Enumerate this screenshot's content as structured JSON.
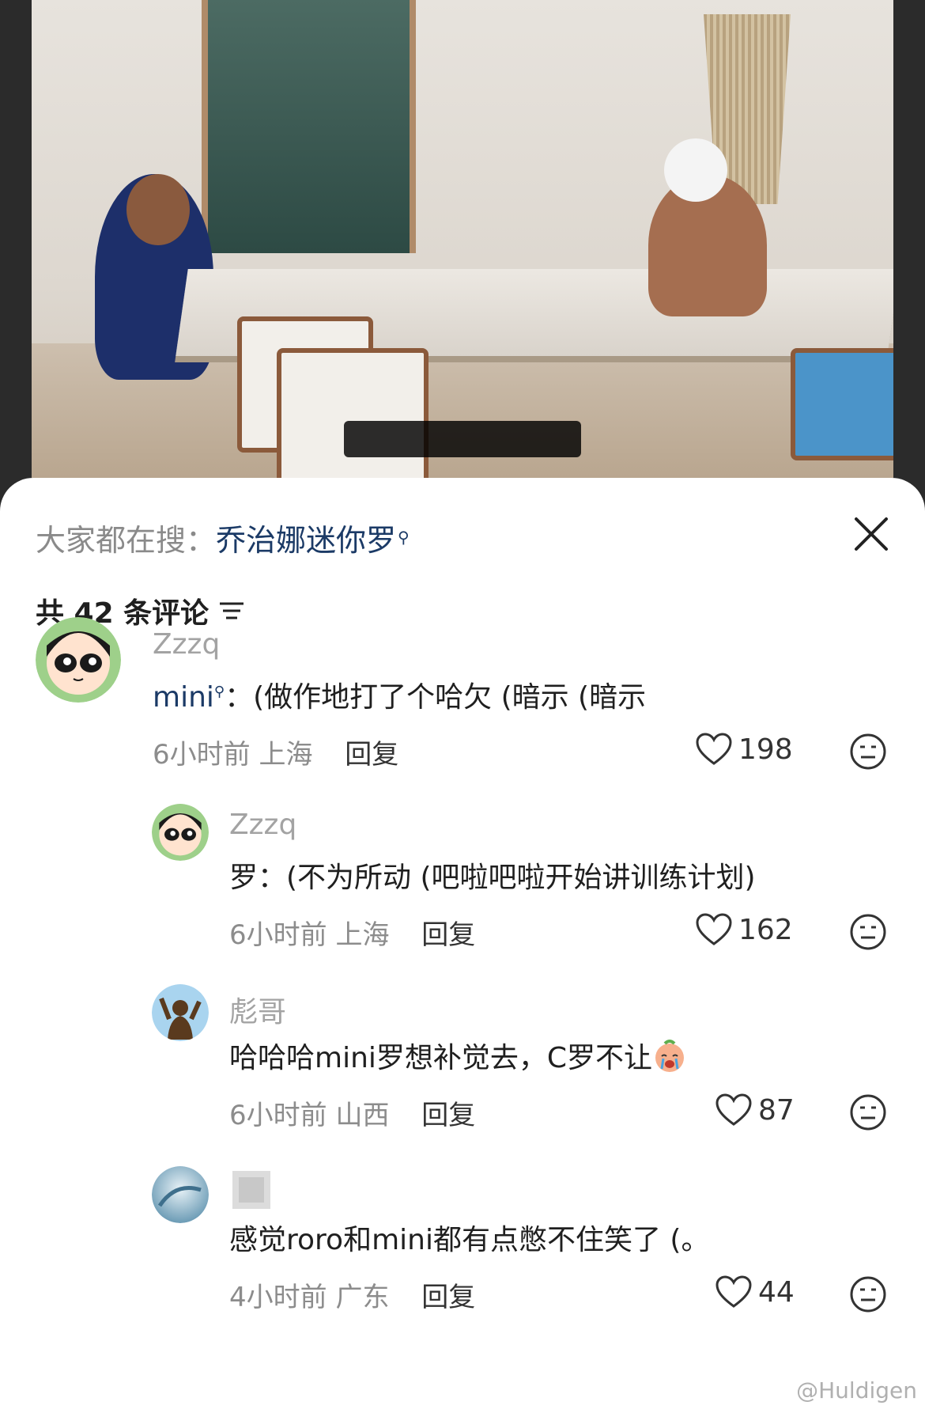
{
  "search": {
    "prefix": "大家都在搜：",
    "term": "乔治娜迷你罗",
    "icon": "search-icon"
  },
  "comments_header": {
    "count_text": "共 42 条评论",
    "sort_icon": "sort-icon"
  },
  "comments": [
    {
      "username": "Zzzq",
      "mention": "mini",
      "text": "：(做作地打了个哈欠 (暗示 (暗示",
      "time": "6小时前",
      "location": "上海",
      "reply_label": "回复",
      "likes": "198"
    },
    {
      "username": "Zzzq",
      "text": "罗：(不为所动 (吧啦吧啦开始讲训练计划)",
      "time": "6小时前",
      "location": "上海",
      "reply_label": "回复",
      "likes": "162"
    },
    {
      "username": "彪哥",
      "text": "哈哈哈mini罗想补觉去，C罗不让",
      "time": "6小时前",
      "location": "山西",
      "reply_label": "回复",
      "likes": "87"
    },
    {
      "username": "",
      "text": "感觉roro和mini都有点憋不住笑了 (。",
      "time": "4小时前",
      "location": "广东",
      "reply_label": "回复",
      "likes": "44"
    }
  ],
  "watermark": "@Huldigen",
  "colors": {
    "link": "#1b3a66",
    "muted": "#8c8c8c",
    "text": "#1f1f1f"
  }
}
